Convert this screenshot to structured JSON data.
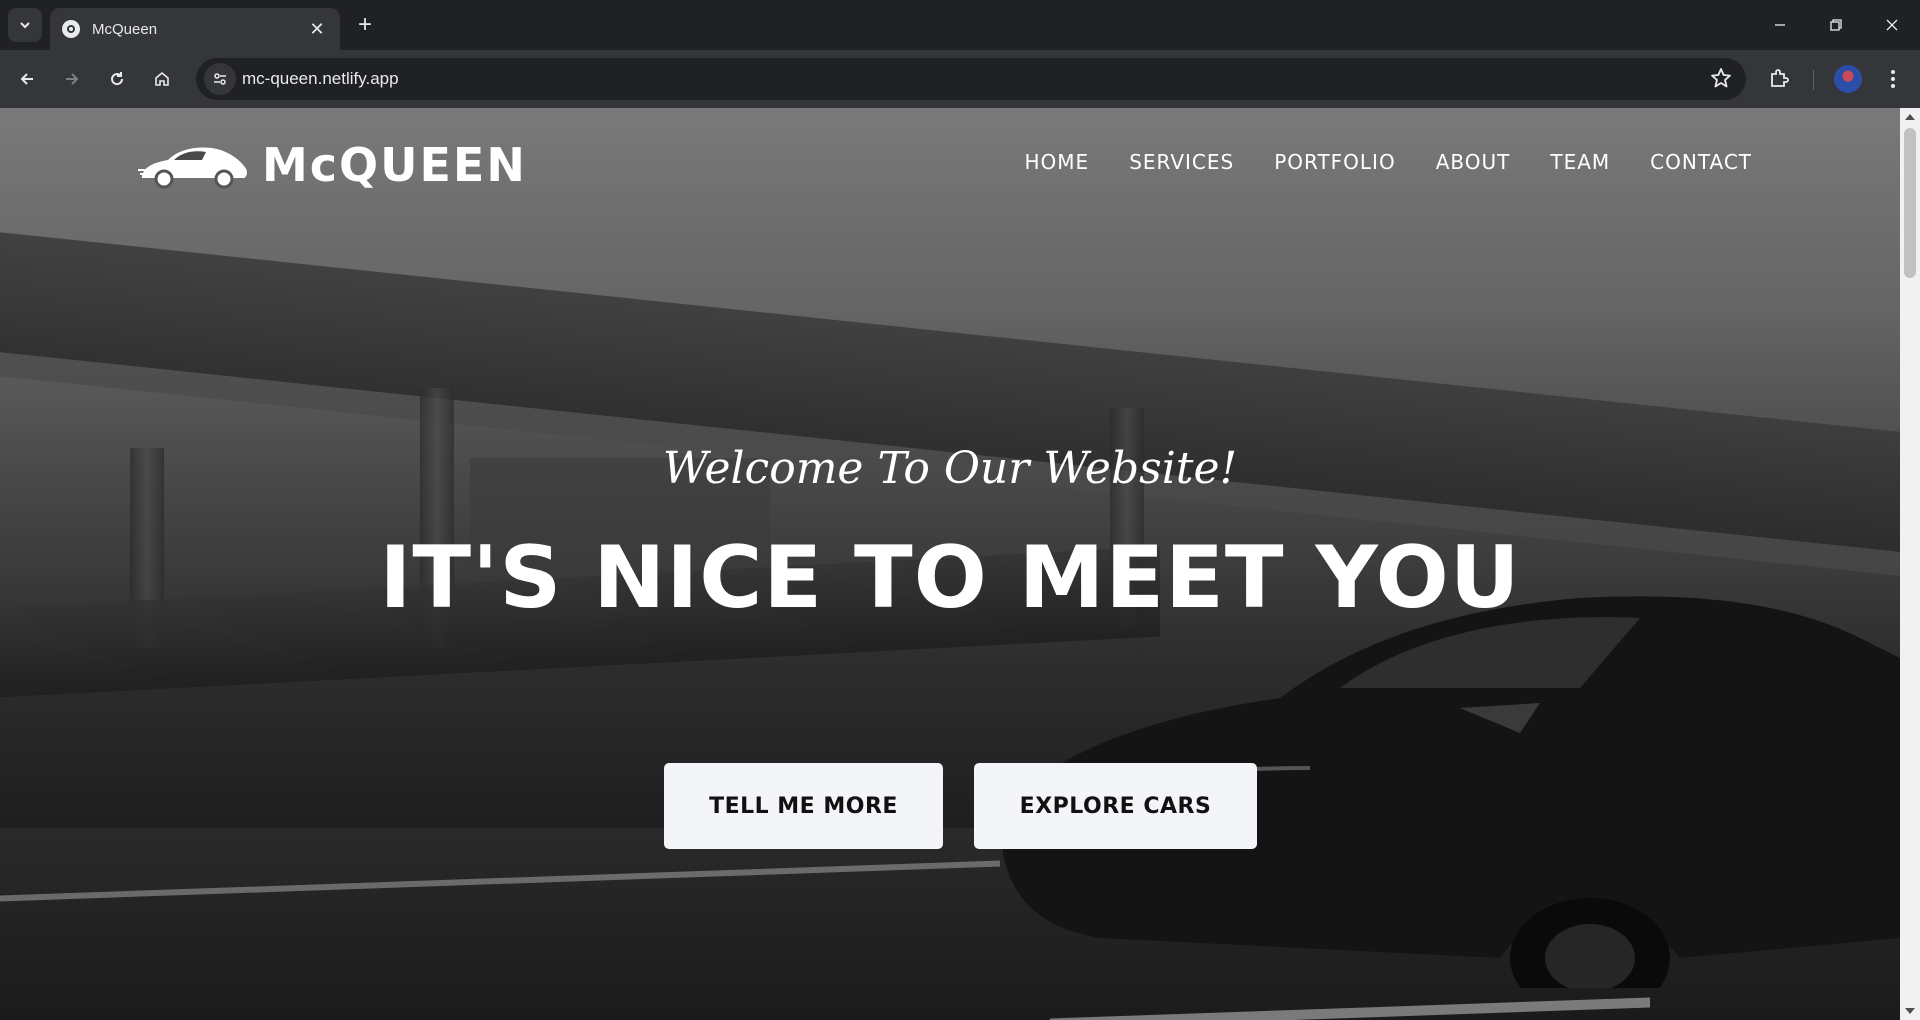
{
  "browser": {
    "tab_title": "McQueen",
    "url": "mc-queen.netlify.app",
    "icons": [
      "tab-search-icon",
      "close-icon",
      "plus-icon",
      "minimize-icon",
      "restore-icon",
      "close-window-icon",
      "back-icon",
      "forward-icon",
      "reload-icon",
      "home-icon",
      "site-info-icon",
      "star-icon",
      "extensions-icon",
      "menu-icon"
    ]
  },
  "site": {
    "logo_text": "McQUEEN",
    "nav": [
      "HOME",
      "SERVICES",
      "PORTFOLIO",
      "ABOUT",
      "TEAM",
      "CONTACT"
    ]
  },
  "hero": {
    "subtitle": "Welcome To Our Website!",
    "title": "IT'S NICE TO MEET YOU",
    "buttons": [
      "TELL ME MORE",
      "EXPLORE CARS"
    ]
  },
  "colors": {
    "chrome_dark": "#202124",
    "chrome_toolbar": "#35363a",
    "button_bg": "#f4f5f8",
    "text_light": "#ffffff"
  }
}
